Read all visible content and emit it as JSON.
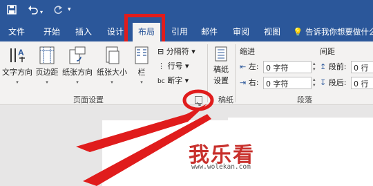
{
  "titlebar": {
    "save_icon": "save-icon",
    "undo_icon": "undo-icon",
    "redo_icon": "redo-icon",
    "customize_icon": "customize-qat-icon"
  },
  "tabs": [
    {
      "label": "文件"
    },
    {
      "label": "开始"
    },
    {
      "label": "插入"
    },
    {
      "label": "设计"
    },
    {
      "label": "布局"
    },
    {
      "label": "引用"
    },
    {
      "label": "邮件"
    },
    {
      "label": "审阅"
    },
    {
      "label": "视图"
    }
  ],
  "tell_me": "告诉我你想要做什么",
  "page_setup": {
    "text_direction": "文字方向",
    "margins": "页边距",
    "orientation": "纸张方向",
    "size": "纸张大小",
    "columns": "栏",
    "breaks": "分隔符",
    "line_numbers": "行号",
    "hyphenation": "断字",
    "group_label": "页面设置"
  },
  "draft_paper": {
    "label_line1": "稿纸",
    "label_line2": "设置",
    "group_label": "稿纸"
  },
  "paragraph": {
    "indent_header": "缩进",
    "spacing_header": "间距",
    "left_label": "左:",
    "left_value": "0 字符",
    "right_label": "右:",
    "right_value": "0 字符",
    "before_label": "段前:",
    "before_value": "0 行",
    "after_label": "段后:",
    "after_value": "0 行",
    "group_label": "段落"
  },
  "watermark": {
    "text": "我乐看",
    "url": "www.wolekan.com"
  },
  "colors": {
    "word_blue": "#2b579a",
    "ribbon_bg": "#f3f2f1",
    "highlight_red": "#e01c1c"
  }
}
